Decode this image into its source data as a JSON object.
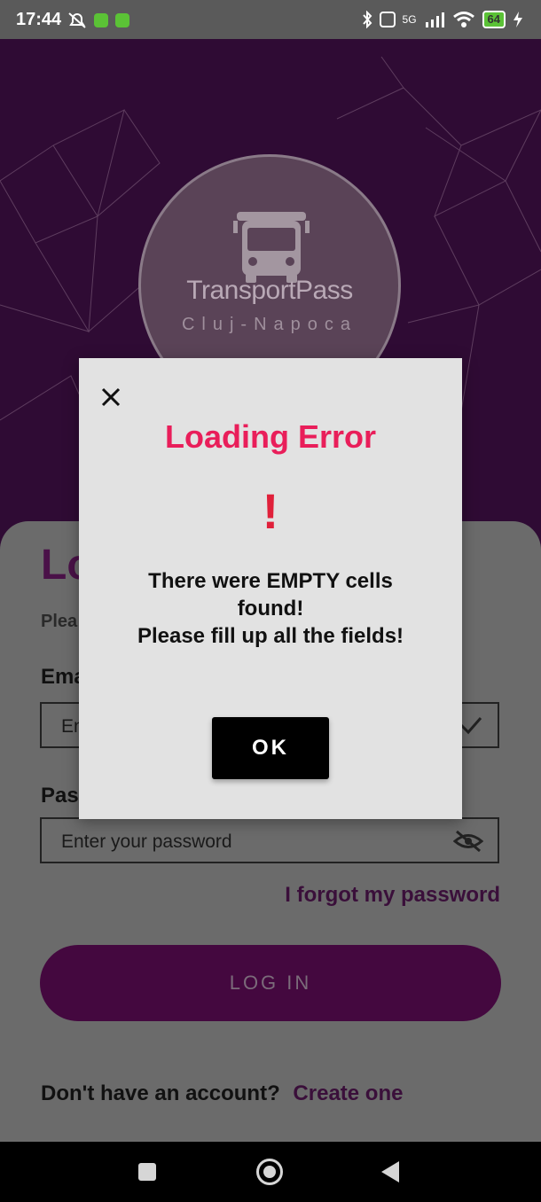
{
  "status_bar": {
    "time": "17:44",
    "battery": "64",
    "network": "5G"
  },
  "logo": {
    "title": "TransportPass",
    "subtitle": "Cluj-Napoca"
  },
  "login": {
    "heading": "Lo",
    "subheading": "Plea",
    "email_label": "Ema",
    "email_placeholder": "En",
    "password_label": "Pas",
    "password_placeholder": "Enter your password",
    "forgot": "I forgot my password",
    "login_button": "LOG IN",
    "no_account": "Don't have an account?",
    "create": "Create one"
  },
  "dialog": {
    "title": "Loading Error",
    "icon": "!",
    "message_line1": "There were EMPTY cells found!",
    "message_line2": "Please fill up all the fields!",
    "ok": "OK"
  },
  "colors": {
    "accent": "#44083f",
    "error_title": "#e91e5a",
    "exclamation": "#e0203a"
  }
}
